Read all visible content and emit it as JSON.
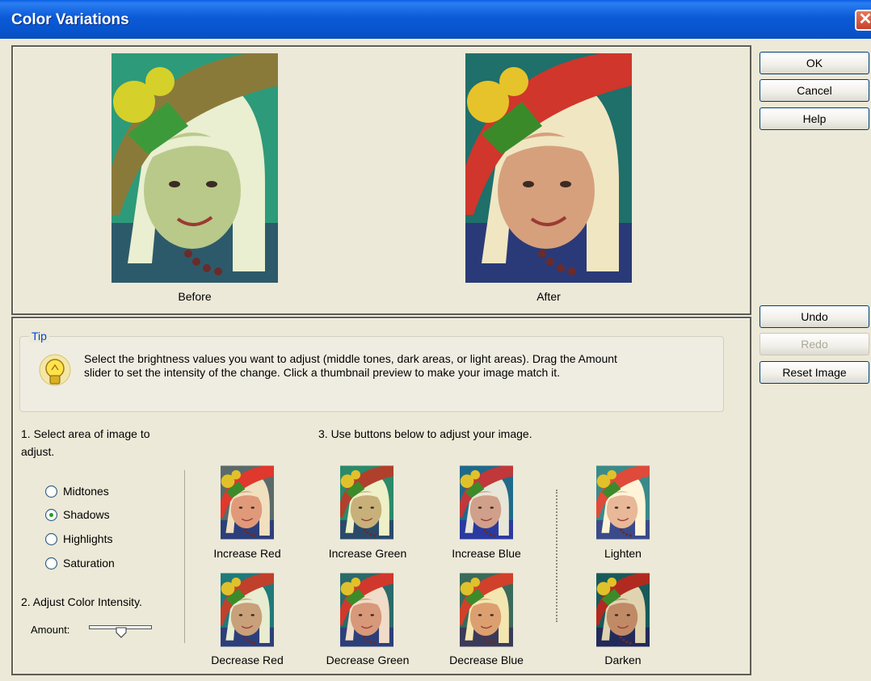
{
  "window": {
    "title": "Color Variations",
    "close_glyph": "✕"
  },
  "preview": {
    "before_label": "Before",
    "after_label": "After"
  },
  "actions": {
    "ok": "OK",
    "cancel": "Cancel",
    "help": "Help",
    "undo": "Undo",
    "redo": "Redo",
    "reset": "Reset Image"
  },
  "tip": {
    "legend": "Tip",
    "icon": "lightbulb-icon",
    "text": "Select the brightness values you want to adjust (middle tones, dark areas, or light areas). Drag the Amount slider to set the intensity of the change. Click a thumbnail preview to make your image match it."
  },
  "step1": {
    "label": "1. Select area of image to adjust."
  },
  "areas": [
    {
      "label": "Midtones",
      "checked": false
    },
    {
      "label": "Shadows",
      "checked": true
    },
    {
      "label": "Highlights",
      "checked": false
    },
    {
      "label": "Saturation",
      "checked": false
    }
  ],
  "step2": {
    "label": "2. Adjust Color Intensity.",
    "amount_label": "Amount:"
  },
  "step3": {
    "label": "3. Use buttons below to adjust your image."
  },
  "variations": {
    "increase_red": "Increase Red",
    "increase_green": "Increase Green",
    "increase_blue": "Increase Blue",
    "lighten": "Lighten",
    "decrease_red": "Decrease Red",
    "decrease_green": "Decrease Green",
    "decrease_blue": "Decrease Blue",
    "darken": "Darken"
  },
  "colors": {
    "titlebar": "#0754cc",
    "face": "#ece9d8",
    "tip_legend": "#0046d5",
    "radio_dot": "#21a121"
  }
}
